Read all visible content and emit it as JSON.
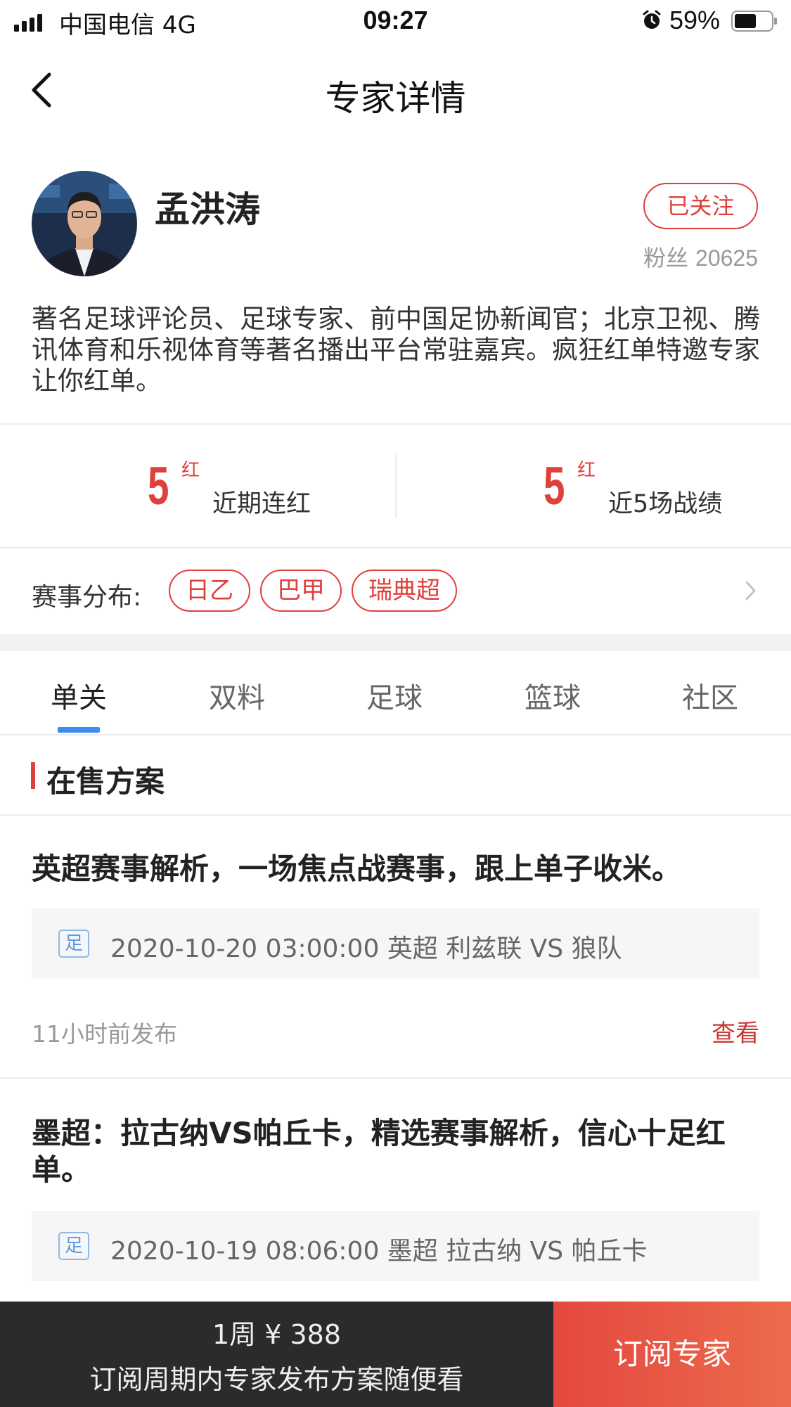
{
  "status_bar": {
    "carrier": "中国电信  4G",
    "time": "09:27",
    "battery": "59%"
  },
  "nav": {
    "title": "专家详情"
  },
  "expert": {
    "name": "孟洪涛",
    "follow_label": "已关注",
    "fans_label": "粉丝",
    "fans_count": "20625",
    "bio": "著名足球评论员、足球专家、前中国足协新闻官；北京卫视、腾讯体育和乐视体育等著名播出平台常驻嘉宾。疯狂红单特邀专家让你红单。"
  },
  "stats": [
    {
      "value": "5",
      "suffix": "红",
      "label": "近期连红"
    },
    {
      "value": "5",
      "suffix": "红",
      "label": "近5场战绩"
    }
  ],
  "distribution": {
    "label": "赛事分布:",
    "tags": [
      "日乙",
      "巴甲",
      "瑞典超"
    ]
  },
  "tabs": [
    "单关",
    "双料",
    "足球",
    "篮球",
    "社区"
  ],
  "section_title": "在售方案",
  "plans": [
    {
      "title": "英超赛事解析，一场焦点战赛事，跟上单子收米。",
      "badge": "足",
      "match": "2020-10-20 03:00:00 英超 利兹联 VS 狼队",
      "published": "11小时前发布",
      "action": "查看"
    },
    {
      "title": "墨超：拉古纳VS帕丘卡，精选赛事解析，信心十足红单。",
      "badge": "足",
      "match": "2020-10-19 08:06:00 墨超 拉古纳 VS 帕丘卡"
    }
  ],
  "bottom": {
    "price": "1周 ¥ 388",
    "desc": "订阅周期内专家发布方案随便看",
    "button": "订阅专家"
  },
  "colors": {
    "accent_red": "#e0403b",
    "tab_indicator": "#3b8ef0",
    "bottom_dark": "#2b2b2b"
  }
}
